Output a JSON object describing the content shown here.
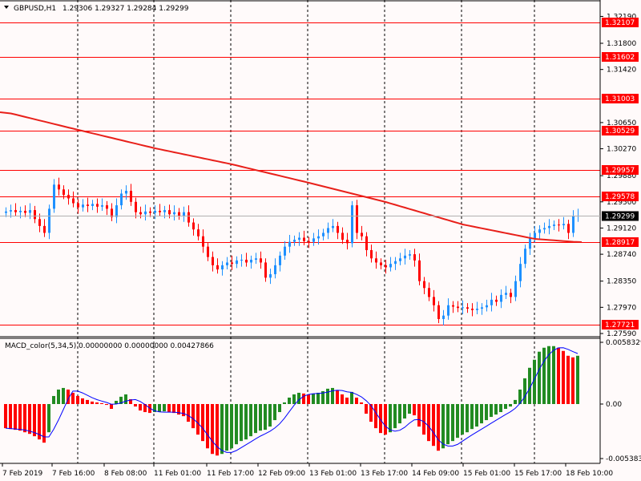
{
  "header": {
    "symbol": "GBPUSD,H1",
    "ohlc": "1.29306 1.29327 1.29284 1.29299",
    "menu_icon": "triangle-down-icon"
  },
  "indicator": {
    "title": "MACD_color(5,34,5)",
    "values": "0.00000000 0.00000000 0.00427866"
  },
  "colors": {
    "bull": "#1e90ff",
    "bear": "#ff0000",
    "ma": "#e8201a",
    "hline": "#ff0000",
    "hist_up": "#228b22",
    "hist_down": "#ff0000",
    "signal": "#0000ff",
    "bg": "#fffafa"
  },
  "price_axis": {
    "ticks": [
      "1.32190",
      "1.31800",
      "1.31420",
      "1.30650",
      "1.30270",
      "1.29880",
      "1.29500",
      "1.29120",
      "1.28740",
      "1.28350",
      "1.27970",
      "1.27590"
    ],
    "levels": [
      "1.32107",
      "1.31602",
      "1.31003",
      "1.30529",
      "1.29957",
      "1.29578",
      "1.28917",
      "1.27721"
    ],
    "current": "1.29299"
  },
  "macd_axis": {
    "top": "0.0058329",
    "zero": "0.00",
    "bottom": "-0.005383"
  },
  "time_axis": [
    "7 Feb 2019",
    "7 Feb 16:00",
    "8 Feb 08:00",
    "11 Feb 01:00",
    "11 Feb 17:00",
    "12 Feb 09:00",
    "13 Feb 01:00",
    "13 Feb 17:00",
    "14 Feb 09:00",
    "15 Feb 01:00",
    "15 Feb 17:00",
    "18 Feb 10:00"
  ],
  "chart_data": {
    "type": "candlestick",
    "first_open": 1.2934,
    "closes": [
      1.2936,
      1.2938,
      1.2935,
      1.2937,
      1.2934,
      1.2938,
      1.2925,
      1.2915,
      1.2905,
      1.294,
      1.2975,
      1.2968,
      1.296,
      1.2955,
      1.2948,
      1.2942,
      1.2946,
      1.2944,
      1.2947,
      1.2943,
      1.2945,
      1.294,
      1.2928,
      1.2945,
      1.2962,
      1.2966,
      1.295,
      1.2935,
      1.2932,
      1.2936,
      1.2934,
      1.2937,
      1.2935,
      1.2938,
      1.2932,
      1.2935,
      1.293,
      1.2935,
      1.292,
      1.291,
      1.29,
      1.2885,
      1.287,
      1.2858,
      1.2852,
      1.2858,
      1.2862,
      1.286,
      1.2865,
      1.2866,
      1.2862,
      1.2866,
      1.2868,
      1.2862,
      1.284,
      1.2845,
      1.2858,
      1.2872,
      1.2885,
      1.2892,
      1.2895,
      1.2898,
      1.2893,
      1.2892,
      1.2897,
      1.29,
      1.2905,
      1.2912,
      1.2915,
      1.2905,
      1.2895,
      1.289,
      1.2945,
      1.2905,
      1.29,
      1.288,
      1.2868,
      1.2862,
      1.2858,
      1.2855,
      1.286,
      1.2864,
      1.2868,
      1.2872,
      1.2874,
      1.2865,
      1.2835,
      1.2825,
      1.2812,
      1.28,
      1.278,
      1.2785,
      1.28,
      1.2798,
      1.2796,
      1.2797,
      1.2795,
      1.2793,
      1.2795,
      1.2797,
      1.28,
      1.2808,
      1.2805,
      1.2815,
      1.2818,
      1.2812,
      1.2835,
      1.286,
      1.2882,
      1.2897,
      1.2905,
      1.291,
      1.2912,
      1.2915,
      1.2917,
      1.2916,
      1.2918,
      1.2905,
      1.293,
      1.293
    ],
    "ma_points": [
      [
        0,
        1.308
      ],
      [
        15,
        1.30544
      ],
      [
        31,
        1.30277
      ],
      [
        47,
        1.30044
      ],
      [
        63,
        1.29777
      ],
      [
        79,
        1.29497
      ],
      [
        95,
        1.29172
      ],
      [
        110,
        1.28962
      ],
      [
        119,
        1.28916
      ]
    ],
    "macd_hist_unit": 0.0001,
    "macd_hist": [
      -22.5,
      -23.3,
      -24,
      -24.8,
      -26.3,
      -27.8,
      -30,
      -33,
      -36,
      -26.3,
      7.5,
      13.5,
      15,
      13.5,
      10.5,
      7.5,
      5.3,
      3.8,
      2.3,
      1.5,
      0.8,
      -0.8,
      -4.5,
      3,
      6.8,
      9,
      4.5,
      -2.3,
      -6,
      -7.5,
      -8.3,
      -7.5,
      -7.5,
      -6.8,
      -7.5,
      -8.3,
      -9.8,
      -11.3,
      -16.5,
      -22.5,
      -28.5,
      -34.5,
      -41.3,
      -46.5,
      -48,
      -46.5,
      -43.5,
      -41.3,
      -37.5,
      -34.5,
      -33,
      -30,
      -27,
      -24.8,
      -24,
      -21,
      -15,
      -7.5,
      1.5,
      6,
      9,
      10.5,
      9.8,
      9,
      9.8,
      10.5,
      12,
      14.3,
      15,
      12.8,
      9,
      6,
      11.3,
      6,
      1.5,
      -9,
      -16.5,
      -22.5,
      -27,
      -28.5,
      -26.3,
      -22.5,
      -18,
      -13.5,
      -9,
      -10.5,
      -21,
      -28.5,
      -34.5,
      -39,
      -43.5,
      -41.3,
      -37.5,
      -34.5,
      -31.5,
      -28.5,
      -26.3,
      -23.3,
      -21,
      -18,
      -15,
      -12,
      -9.8,
      -7.5,
      -4.5,
      -2.3,
      3.8,
      13.5,
      24,
      33.8,
      41.3,
      48.8,
      52.5,
      54,
      54,
      52.5,
      49.5,
      45,
      43.5,
      45
    ],
    "price_range": [
      1.2755,
      1.3225
    ],
    "macd_range": [
      -0.005383,
      0.0058329
    ]
  }
}
